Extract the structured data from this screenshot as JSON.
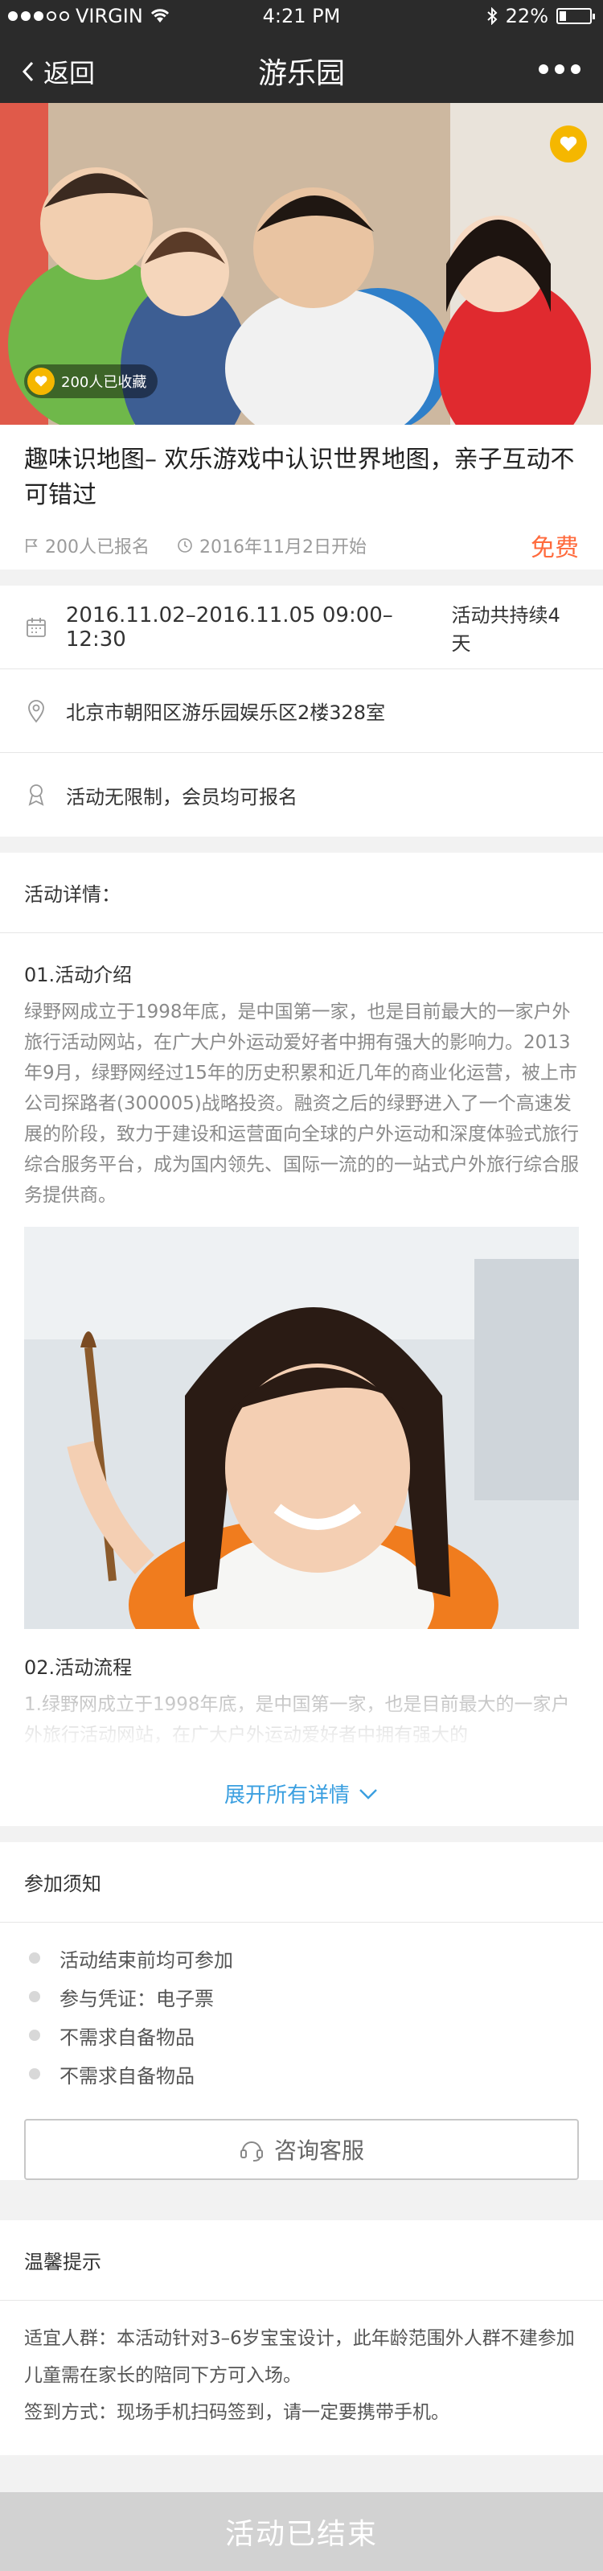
{
  "status_bar": {
    "carrier": "VIRGIN",
    "time": "4:21 PM",
    "battery": "22%",
    "battery_level": 0.22
  },
  "nav": {
    "back_label": "返回",
    "title": "游乐园"
  },
  "hero": {
    "favorites_text": "200人已收藏"
  },
  "event": {
    "title": "趣味识地图– 欢乐游戏中认识世界地图，亲子互动不可错过",
    "signed_up": "200人已报名",
    "start_date": "2016年11月2日开始",
    "price": "免费"
  },
  "info": {
    "datetime": "2016.11.02–2016.11.05  09:00–12:30",
    "duration": "活动共持续4天",
    "address": "北京市朝阳区游乐园娱乐区2楼328室",
    "eligibility": "活动无限制，会员均可报名"
  },
  "details": {
    "heading": "活动详情：",
    "intro_title": "01.活动介绍",
    "intro_text": "绿野网成立于1998年底，是中国第一家，也是目前最大的一家户外旅行活动网站，在广大户外运动爱好者中拥有强大的影响力。2013年9月，绿野网经过15年的历史积累和近几年的商业化运营，被上市公司探路者(300005)战略投资。融资之后的绿野进入了一个高速发展的阶段，致力于建设和运营面向全球的户外运动和深度体验式旅行综合服务平台，成为国内领先、国际一流的的一站式户外旅行综合服务提供商。",
    "flow_title": "02.活动流程",
    "flow_text": "1.绿野网成立于1998年底，是中国第一家，也是目前最大的一家户外旅行活动网站，在广大户外运动爱好者中拥有强大的",
    "expand_label": "展开所有详情"
  },
  "notice": {
    "heading": "参加须知",
    "items": [
      "活动结束前均可参加",
      "参与凭证：电子票",
      "不需求自备物品",
      "不需求自备物品"
    ],
    "consult_label": "咨询客服"
  },
  "tips": {
    "heading": "温馨提示",
    "lines": [
      "适宜人群：本活动针对3–6岁宝宝设计，此年龄范围外人群不建参加",
      "儿童需在家长的陪同下方可入场。",
      "签到方式：现场手机扫码签到，请一定要携带手机。"
    ]
  },
  "bottom": {
    "status_label": "活动已结束"
  },
  "colors": {
    "accent_price": "#ff6a3c",
    "link_blue": "#3a9fe0",
    "fav_yellow": "#f5b700"
  }
}
